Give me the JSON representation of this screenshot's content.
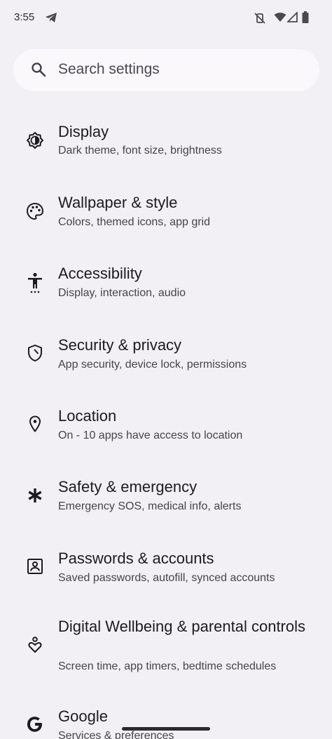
{
  "status": {
    "time": "3:55"
  },
  "search": {
    "placeholder": "Search settings"
  },
  "items": [
    {
      "title": "Display",
      "subtitle": "Dark theme, font size, brightness",
      "icon": "display-icon"
    },
    {
      "title": "Wallpaper & style",
      "subtitle": "Colors, themed icons, app grid",
      "icon": "palette-icon"
    },
    {
      "title": "Accessibility",
      "subtitle": "Display, interaction, audio",
      "icon": "accessibility-icon"
    },
    {
      "title": "Security & privacy",
      "subtitle": "App security, device lock, permissions",
      "icon": "shield-icon"
    },
    {
      "title": "Location",
      "subtitle": "On - 10 apps have access to location",
      "icon": "location-pin-icon"
    },
    {
      "title": "Safety & emergency",
      "subtitle": "Emergency SOS, medical info, alerts",
      "icon": "asterisk-icon"
    },
    {
      "title": "Passwords & accounts",
      "subtitle": "Saved passwords, autofill, synced accounts",
      "icon": "account-box-icon"
    },
    {
      "title": "Digital Wellbeing & parental controls",
      "subtitle": "Screen time, app timers, bedtime schedules",
      "icon": "wellbeing-icon"
    },
    {
      "title": "Google",
      "subtitle": "Services & preferences",
      "icon": "google-icon"
    }
  ]
}
